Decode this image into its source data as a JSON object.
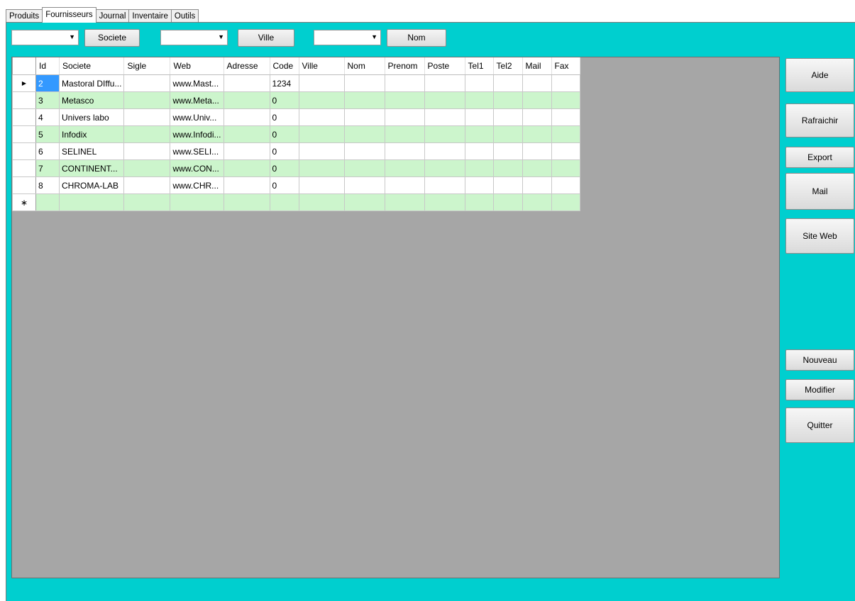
{
  "tabs": [
    "Produits",
    "Fournisseurs",
    "Journal",
    "Inventaire",
    "Outils"
  ],
  "active_tab": "Fournisseurs",
  "filters": {
    "societe_button": "Societe",
    "ville_button": "Ville",
    "nom_button": "Nom",
    "combo_arrow": "▼"
  },
  "grid": {
    "columns": [
      "Id",
      "Societe",
      "Sigle",
      "Web",
      "Adresse",
      "Code",
      "Ville",
      "Nom",
      "Prenom",
      "Poste",
      "Tel1",
      "Tel2",
      "Mail",
      "Fax"
    ],
    "current_row_marker": "▶",
    "new_row_marker": "∗",
    "rows": [
      {
        "id": "2",
        "societe": "Mastoral DIffu...",
        "sigle": "",
        "web": "www.Mast...",
        "adresse": "",
        "code": "1234",
        "ville": "",
        "nom": "",
        "prenom": "",
        "poste": "",
        "tel1": "",
        "tel2": "",
        "mail": "",
        "fax": ""
      },
      {
        "id": "3",
        "societe": "Metasco",
        "sigle": "",
        "web": "www.Meta...",
        "adresse": "",
        "code": "0",
        "ville": "",
        "nom": "",
        "prenom": "",
        "poste": "",
        "tel1": "",
        "tel2": "",
        "mail": "",
        "fax": ""
      },
      {
        "id": "4",
        "societe": "Univers labo",
        "sigle": "",
        "web": "www.Univ...",
        "adresse": "",
        "code": "0",
        "ville": "",
        "nom": "",
        "prenom": "",
        "poste": "",
        "tel1": "",
        "tel2": "",
        "mail": "",
        "fax": ""
      },
      {
        "id": "5",
        "societe": "Infodix",
        "sigle": "",
        "web": "www.Infodi...",
        "adresse": "",
        "code": "0",
        "ville": "",
        "nom": "",
        "prenom": "",
        "poste": "",
        "tel1": "",
        "tel2": "",
        "mail": "",
        "fax": ""
      },
      {
        "id": "6",
        "societe": "SELINEL",
        "sigle": "",
        "web": "www.SELI...",
        "adresse": "",
        "code": "0",
        "ville": "",
        "nom": "",
        "prenom": "",
        "poste": "",
        "tel1": "",
        "tel2": "",
        "mail": "",
        "fax": ""
      },
      {
        "id": "7",
        "societe": "CONTINENT...",
        "sigle": "",
        "web": "www.CON...",
        "adresse": "",
        "code": "0",
        "ville": "",
        "nom": "",
        "prenom": "",
        "poste": "",
        "tel1": "",
        "tel2": "",
        "mail": "",
        "fax": ""
      },
      {
        "id": "8",
        "societe": "CHROMA-LAB",
        "sigle": "",
        "web": "www.CHR...",
        "adresse": "",
        "code": "0",
        "ville": "",
        "nom": "",
        "prenom": "",
        "poste": "",
        "tel1": "",
        "tel2": "",
        "mail": "",
        "fax": ""
      }
    ]
  },
  "side_buttons": {
    "aide": "Aide",
    "rafraichir": "Rafraichir",
    "export": "Export",
    "mail": "Mail",
    "site_web": "Site Web",
    "nouveau": "Nouveau",
    "modifier": "Modifier",
    "quitter": "Quitter"
  },
  "colors": {
    "panel_background": "#00cfcf",
    "grid_background": "#a6a6a6",
    "alternate_row": "#ccf5cc",
    "selected_cell": "#3399ff"
  }
}
